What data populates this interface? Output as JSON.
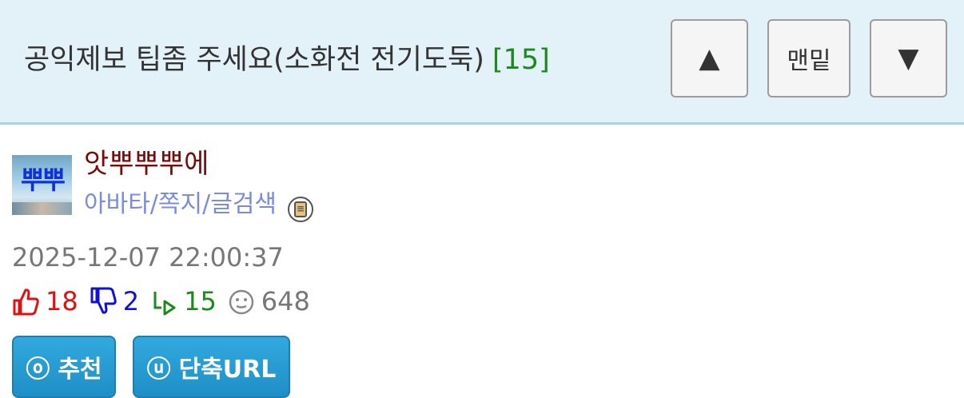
{
  "header": {
    "title": "공익제보 팁좀 주세요(소화전 전기도둑)",
    "comment_count": "[15]",
    "nav": {
      "up": "▲",
      "bottom": "맨밑",
      "down": "▼"
    }
  },
  "author": {
    "nickname": "앗뿌뿌뿌에",
    "links": "아바타/쪽지/글검색",
    "avatar_text": "뿌뿌",
    "badge_icon": "memo-badge-icon"
  },
  "post": {
    "datetime": "2025-12-07 22:00:37",
    "stats": {
      "recommend": "18",
      "oppose": "2",
      "replies": "15",
      "views": "648"
    }
  },
  "actions": {
    "recommend_icon": "ⓞ",
    "recommend_label": "추천",
    "shorturl_icon": "ⓤ",
    "shorturl_label": "단축URL"
  },
  "colors": {
    "header_bg": "#e3f1f8",
    "recommend": "#e01010",
    "oppose": "#1010d8",
    "reply": "#1a8a1a",
    "button": "#1e8fc6",
    "nickname": "#7a0a0a",
    "links": "#7b8be0"
  }
}
